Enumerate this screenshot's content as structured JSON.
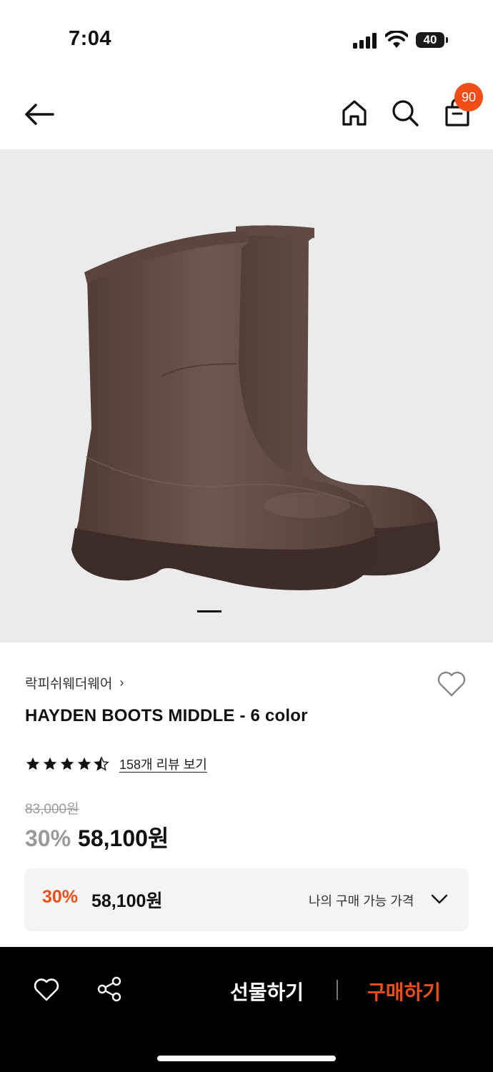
{
  "status_bar": {
    "time": "7:04",
    "battery": "40"
  },
  "header": {
    "back_icon": "arrow-left-icon",
    "home_icon": "home-icon",
    "search_icon": "search-icon",
    "cart_icon": "shopping-bag-icon",
    "cart_count": "90",
    "accent_color": "#f04e16"
  },
  "product": {
    "image_alt_icon": "rain-boots-image",
    "brand": "락피쉬웨더웨어",
    "brand_chevron": "›",
    "title": "HAYDEN BOOTS MIDDLE - 6 color",
    "rating": 4.5,
    "review_link": "158개 리뷰 보기",
    "original_price": "83,000원",
    "discount": "30%",
    "sale_price": "58,100원"
  },
  "my_price": {
    "discount": "30%",
    "price": "58,100원",
    "label": "나의 구매 가능 가격"
  },
  "bottom_bar": {
    "gift_label": "선물하기",
    "buy_label": "구매하기"
  }
}
